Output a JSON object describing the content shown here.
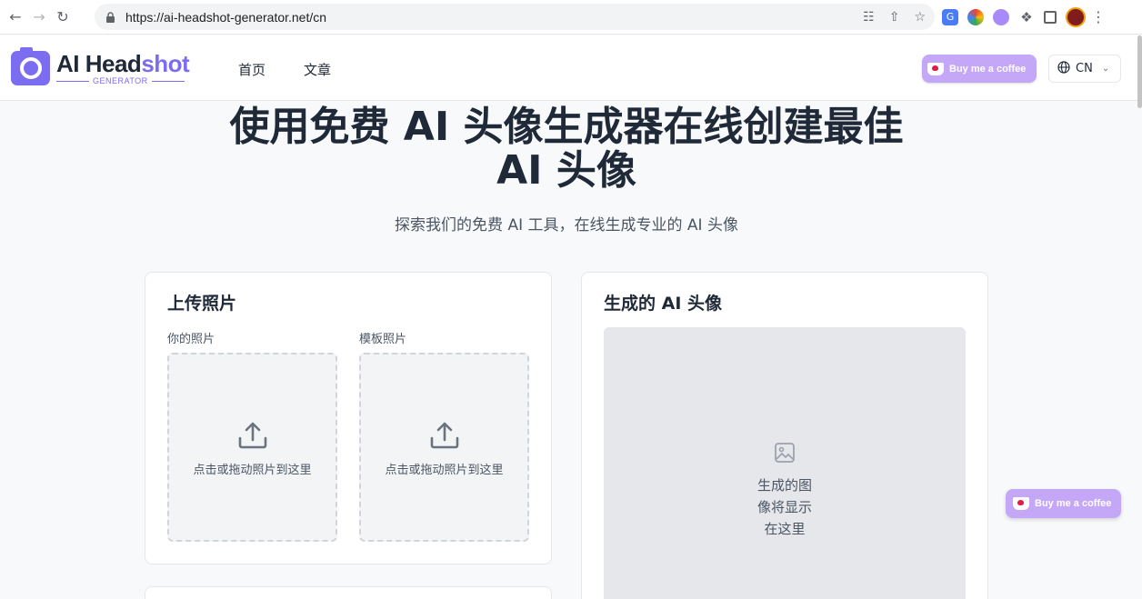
{
  "browser": {
    "url": "https://ai-headshot-generator.net/cn"
  },
  "site": {
    "logo_main_a": "AI Head",
    "logo_main_b": "shot",
    "logo_sub": "GENERATOR",
    "nav": [
      {
        "label": "首页"
      },
      {
        "label": "文章"
      }
    ],
    "coffee_label": "Buy me a coffee",
    "language": "CN"
  },
  "hero": {
    "title": "使用免费 AI 头像生成器在线创建最佳 AI 头像",
    "subtitle": "探索我们的免费 AI 工具，在线生成专业的 AI 头像"
  },
  "upload": {
    "title": "上传照片",
    "your_photo_label": "你的照片",
    "template_photo_label": "模板照片",
    "dropzone_text": "点击或拖动照片到这里"
  },
  "result": {
    "title": "生成的 AI 头像",
    "placeholder": "生成的图像将显示在这里"
  },
  "colors": {
    "brand": "#7c6cf0",
    "coffee": "#c4a8f7"
  }
}
